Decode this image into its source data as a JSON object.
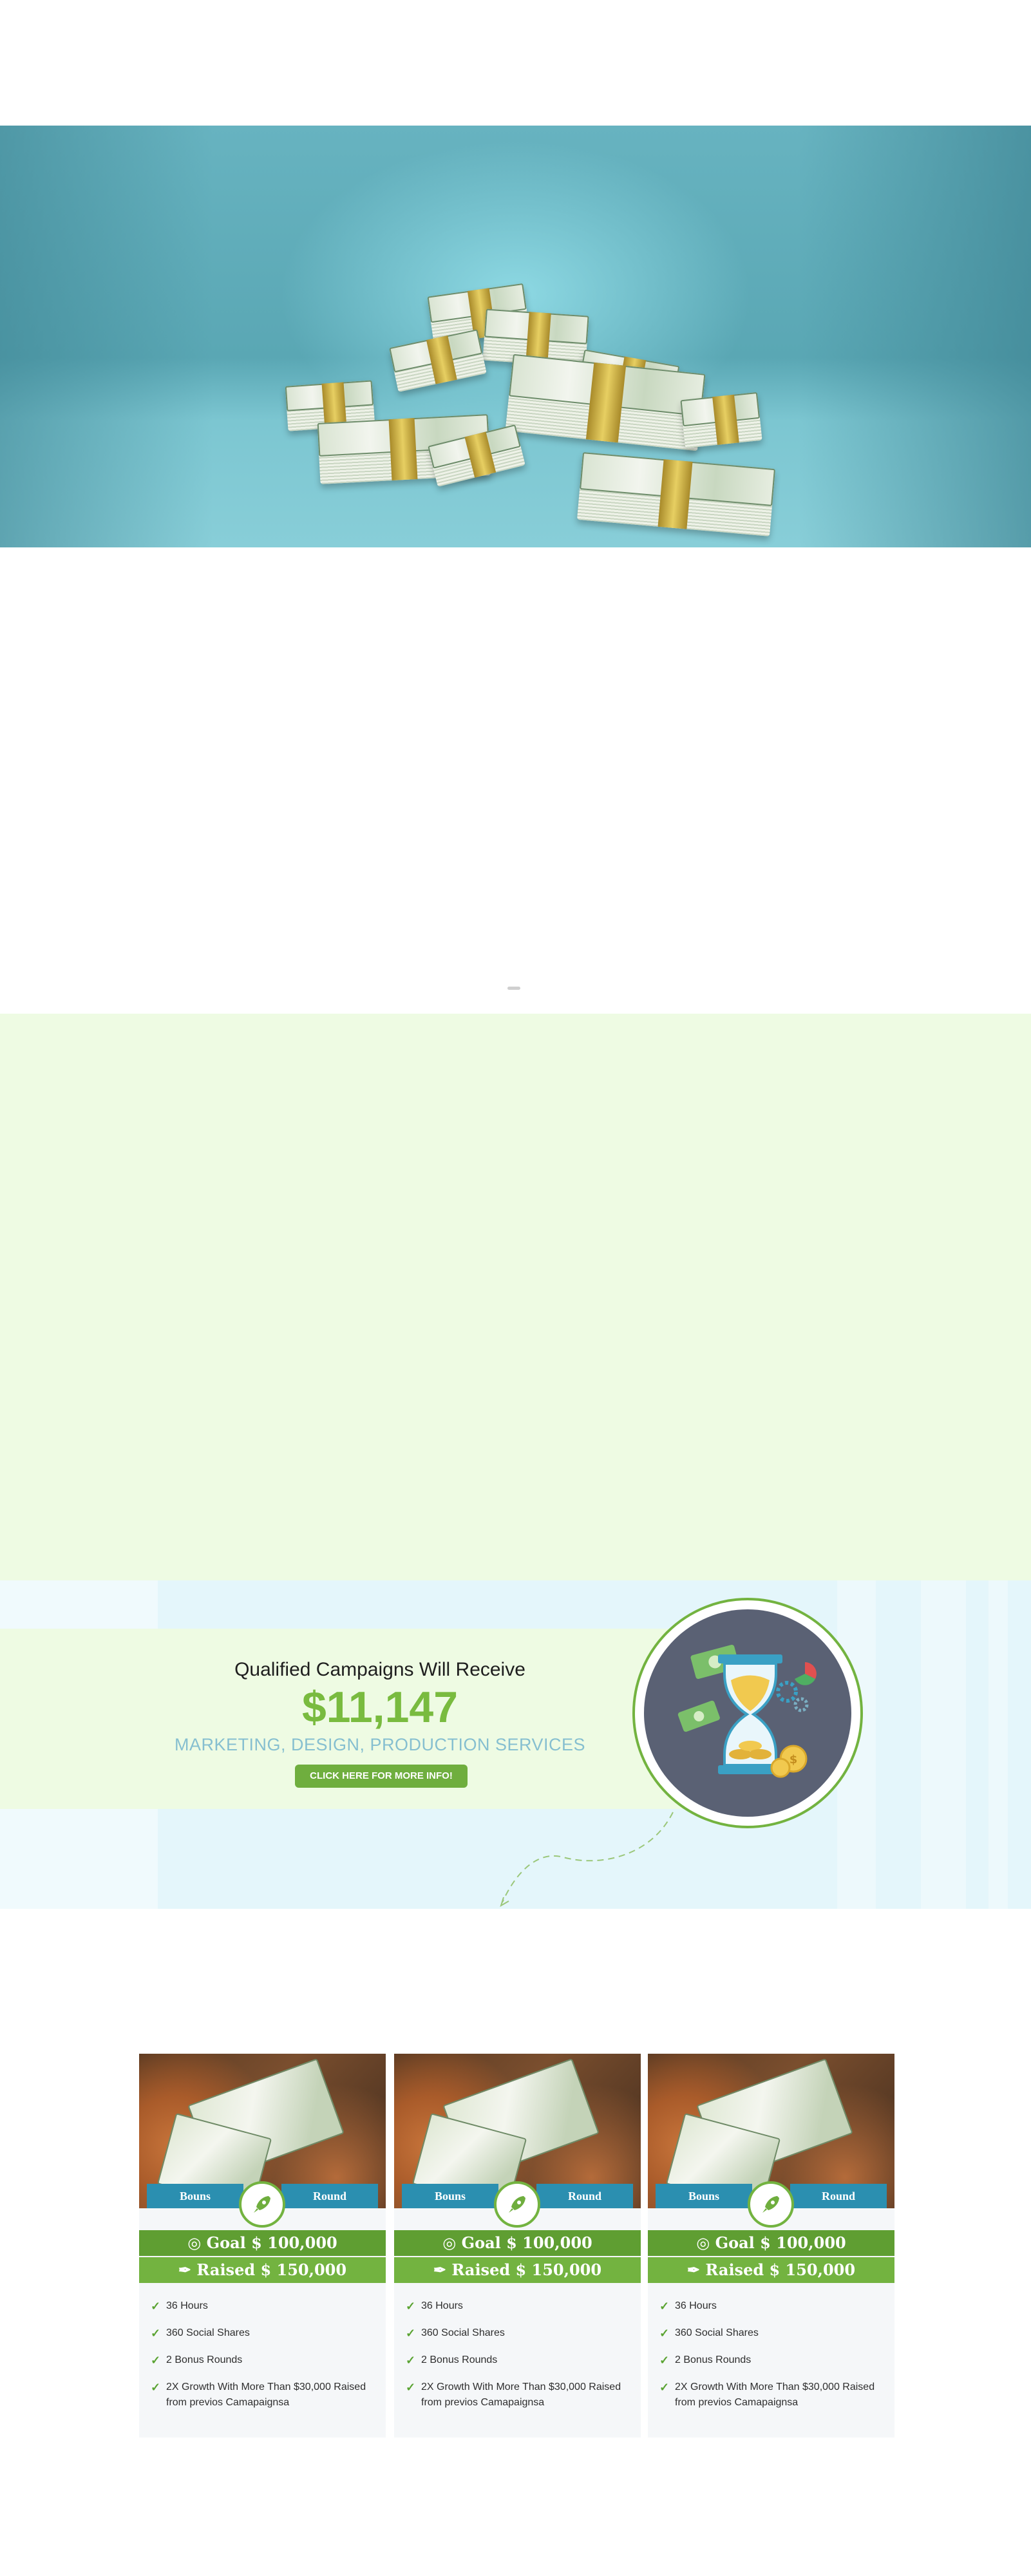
{
  "hero": {
    "image_alt": "stacks of dollar bills",
    "icon": "money-stacks-icon"
  },
  "campaign": {
    "headline": "Qualified Campaigns Will Receive",
    "amount": "$11,147",
    "services": "MARKETING, DESIGN, PRODUCTION SERVICES",
    "cta_label": "CLICK HERE FOR MORE INFO!",
    "illustration": "hourglass-money-icon",
    "accent_color": "#79bb3f",
    "cta_color": "#6fae3e"
  },
  "cards": [
    {
      "ribbon_left": "Bouns",
      "ribbon_right": "Round",
      "goal": "Goal $ 100,000",
      "raised": "Raised $ 150,000",
      "features": [
        "36 Hours",
        "360 Social Shares",
        "2 Bonus Rounds",
        "2X Growth With More Than $30,000 Raised from previos Camapaignsa"
      ]
    },
    {
      "ribbon_left": "Bouns",
      "ribbon_right": "Round",
      "goal": "Goal $ 100,000",
      "raised": "Raised $ 150,000",
      "features": [
        "36 Hours",
        "360 Social Shares",
        "2 Bonus Rounds",
        "2X Growth With More Than $30,000 Raised from previos Camapaignsa"
      ]
    },
    {
      "ribbon_left": "Bouns",
      "ribbon_right": "Round",
      "goal": "Goal $ 100,000",
      "raised": "Raised $ 150,000",
      "features": [
        "36 Hours",
        "360 Social Shares",
        "2 Bonus Rounds",
        "2X Growth With More Than $30,000 Raised from previos Camapaignsa"
      ]
    }
  ],
  "colors": {
    "hero_teal": "#67b3c0",
    "green_area": "#eefbe3",
    "ribbon_blue": "#2b8fb0",
    "goal_green": "#5f9e32",
    "raised_green": "#73b340"
  }
}
